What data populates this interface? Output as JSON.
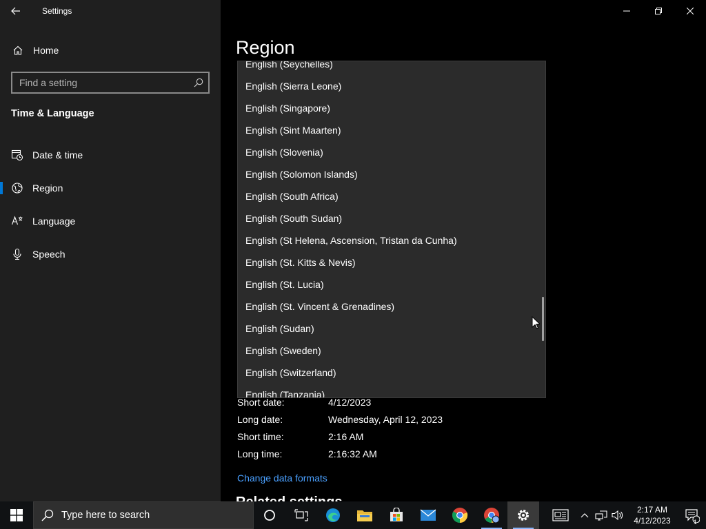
{
  "app": {
    "title": "Settings"
  },
  "sidebar": {
    "home_label": "Home",
    "search_placeholder": "Find a setting",
    "section_title": "Time & Language",
    "items": [
      {
        "label": "Date & time",
        "icon": "clock-calendar-icon"
      },
      {
        "label": "Region",
        "icon": "globe-icon",
        "selected": true
      },
      {
        "label": "Language",
        "icon": "language-icon"
      },
      {
        "label": "Speech",
        "icon": "microphone-icon"
      }
    ]
  },
  "main": {
    "title": "Region",
    "dropdown_items": [
      "English (Seychelles)",
      "English (Sierra Leone)",
      "English (Singapore)",
      "English (Sint Maarten)",
      "English (Slovenia)",
      "English (Solomon Islands)",
      "English (South Africa)",
      "English (South Sudan)",
      "English (St Helena, Ascension, Tristan da Cunha)",
      "English (St. Kitts & Nevis)",
      "English (St. Lucia)",
      "English (St. Vincent & Grenadines)",
      "English (Sudan)",
      "English (Sweden)",
      "English (Switzerland)",
      "English (Tanzania)"
    ],
    "formats": [
      {
        "label": "Short date:",
        "value": "4/12/2023"
      },
      {
        "label": "Long date:",
        "value": "Wednesday, April 12, 2023"
      },
      {
        "label": "Short time:",
        "value": "2:16 AM"
      },
      {
        "label": "Long time:",
        "value": "2:16:32 AM"
      }
    ],
    "change_link": "Change data formats",
    "related_heading": "Related settings"
  },
  "taskbar": {
    "search_placeholder": "Type here to search",
    "time": "2:17 AM",
    "date": "4/12/2023",
    "notification_count": "1"
  },
  "colors": {
    "accent": "#0078d7",
    "link": "#4aa0ff",
    "sidebar_bg": "#1f1f1f",
    "dropdown_bg": "#2b2b2b"
  }
}
